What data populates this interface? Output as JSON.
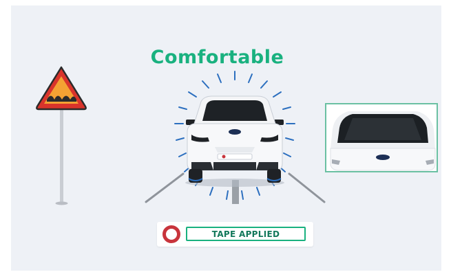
{
  "scene": {
    "title": "Comfortable",
    "status_badge": {
      "label": "TAPE APPLIED"
    },
    "colors": {
      "accent_green": "#19b17f",
      "badge_ring_red": "#c8343c",
      "sign_red": "#d9342b",
      "sign_orange": "#f4a233",
      "vibration_blue": "#2c6fbf"
    },
    "icons": [
      "speed-bump-warning-sign-icon",
      "car-front-icon",
      "car-rear-closeup-icon",
      "record-circle-icon"
    ]
  }
}
